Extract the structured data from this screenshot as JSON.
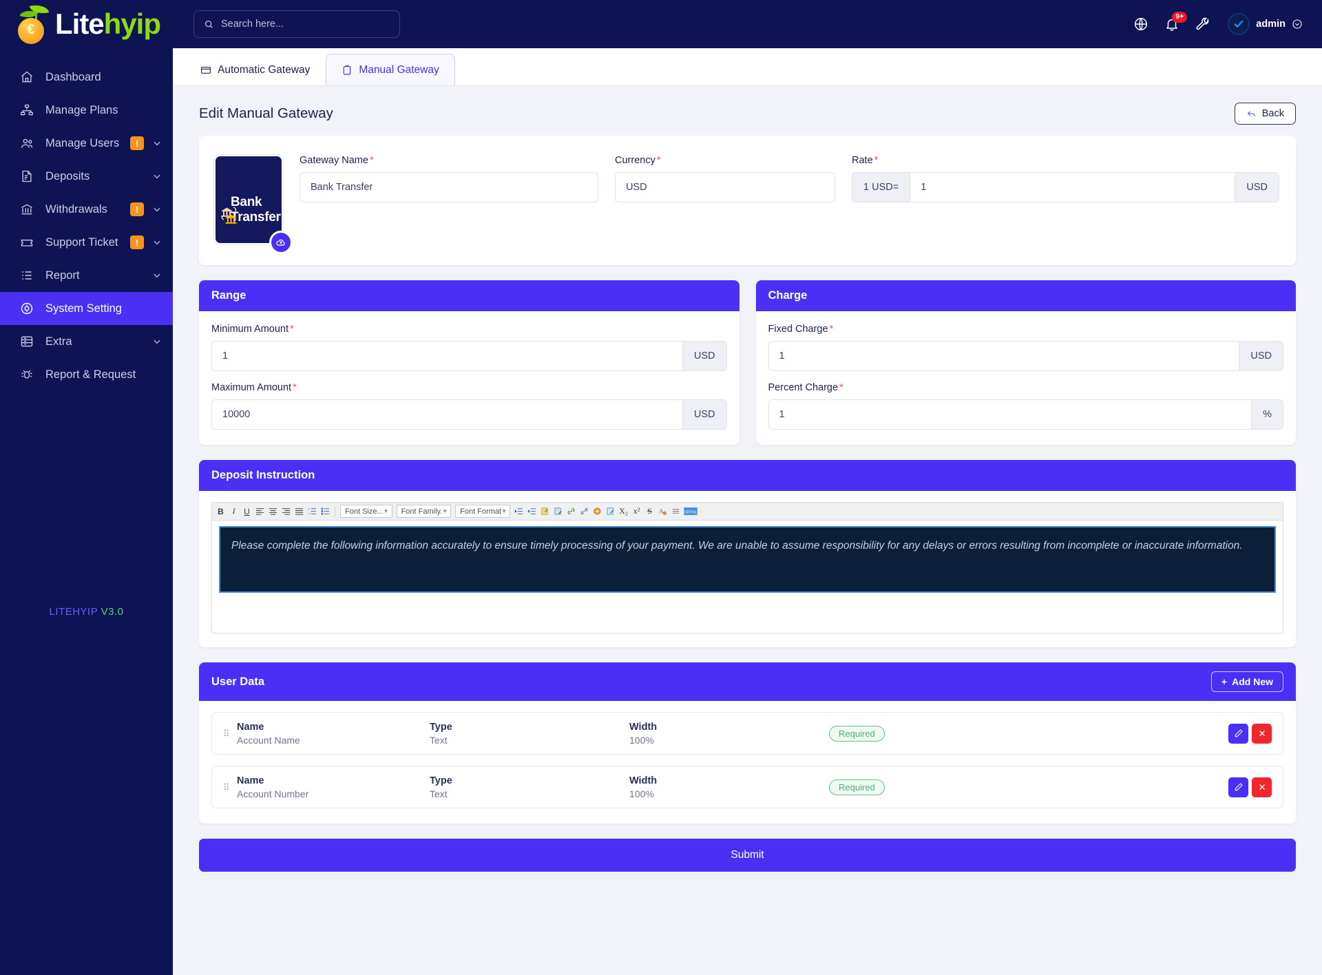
{
  "brand": {
    "part1": "Lite",
    "part2": "hyip",
    "version_name": "LITEHYIP",
    "version_num": "V3.0"
  },
  "sidebar": {
    "items": [
      {
        "label": "Dashboard",
        "icon": "home-icon",
        "badge": null,
        "chevron": false,
        "active": false
      },
      {
        "label": "Manage Plans",
        "icon": "sitemap-icon",
        "badge": null,
        "chevron": false,
        "active": false
      },
      {
        "label": "Manage Users",
        "icon": "users-icon",
        "badge": "!",
        "chevron": true,
        "active": false
      },
      {
        "label": "Deposits",
        "icon": "invoice-dollar-icon",
        "badge": null,
        "chevron": true,
        "active": false
      },
      {
        "label": "Withdrawals",
        "icon": "bank-icon",
        "badge": "!",
        "chevron": true,
        "active": false
      },
      {
        "label": "Support Ticket",
        "icon": "ticket-icon",
        "badge": "!",
        "chevron": true,
        "active": false
      },
      {
        "label": "Report",
        "icon": "list-icon",
        "badge": null,
        "chevron": true,
        "active": false
      },
      {
        "label": "System Setting",
        "icon": "gear-circle-icon",
        "badge": null,
        "chevron": false,
        "active": true
      },
      {
        "label": "Extra",
        "icon": "server-icon",
        "badge": null,
        "chevron": true,
        "active": false
      },
      {
        "label": "Report & Request",
        "icon": "bug-icon",
        "badge": null,
        "chevron": false,
        "active": false
      }
    ]
  },
  "topbar": {
    "search_placeholder": "Search here...",
    "notification_count": "9+",
    "username": "admin",
    "icons": [
      "globe-icon",
      "bell-icon",
      "wrench-icon"
    ]
  },
  "tabs": [
    {
      "label": "Automatic Gateway",
      "icon": "credit-card-icon",
      "active": false
    },
    {
      "label": "Manual Gateway",
      "icon": "clipboard-icon",
      "active": true
    }
  ],
  "page": {
    "title": "Edit Manual Gateway",
    "back_label": "Back"
  },
  "gateway": {
    "logo_text": "Bank Transfer",
    "name_label": "Gateway Name",
    "name_value": "Bank Transfer",
    "currency_label": "Currency",
    "currency_value": "USD",
    "rate_label": "Rate",
    "rate_prefix": "1 USD=",
    "rate_value": "1",
    "rate_suffix": "USD"
  },
  "range": {
    "title": "Range",
    "min_label": "Minimum Amount",
    "min_value": "1",
    "min_suffix": "USD",
    "max_label": "Maximum Amount",
    "max_value": "10000",
    "max_suffix": "USD"
  },
  "charge": {
    "title": "Charge",
    "fixed_label": "Fixed Charge",
    "fixed_value": "1",
    "fixed_suffix": "USD",
    "percent_label": "Percent Charge",
    "percent_value": "1",
    "percent_suffix": "%"
  },
  "editor": {
    "title": "Deposit Instruction",
    "toolbar_selects": [
      "Font Size...",
      "Font Family.",
      "Font Format"
    ],
    "content": "Please complete the following information accurately to ensure timely processing of your payment. We are unable to assume responsibility for any delays or errors resulting from incomplete or inaccurate information."
  },
  "user_data": {
    "title": "User Data",
    "add_label": "Add New",
    "headers": {
      "name": "Name",
      "type": "Type",
      "width": "Width"
    },
    "rows": [
      {
        "name": "Account Name",
        "type": "Text",
        "width": "100%",
        "status": "Required"
      },
      {
        "name": "Account Number",
        "type": "Text",
        "width": "100%",
        "status": "Required"
      }
    ]
  },
  "submit_label": "Submit",
  "colors": {
    "accent": "#4b2ff5",
    "sidebar": "#0e1453",
    "danger": "#f0282d",
    "warn": "#f7941e"
  }
}
